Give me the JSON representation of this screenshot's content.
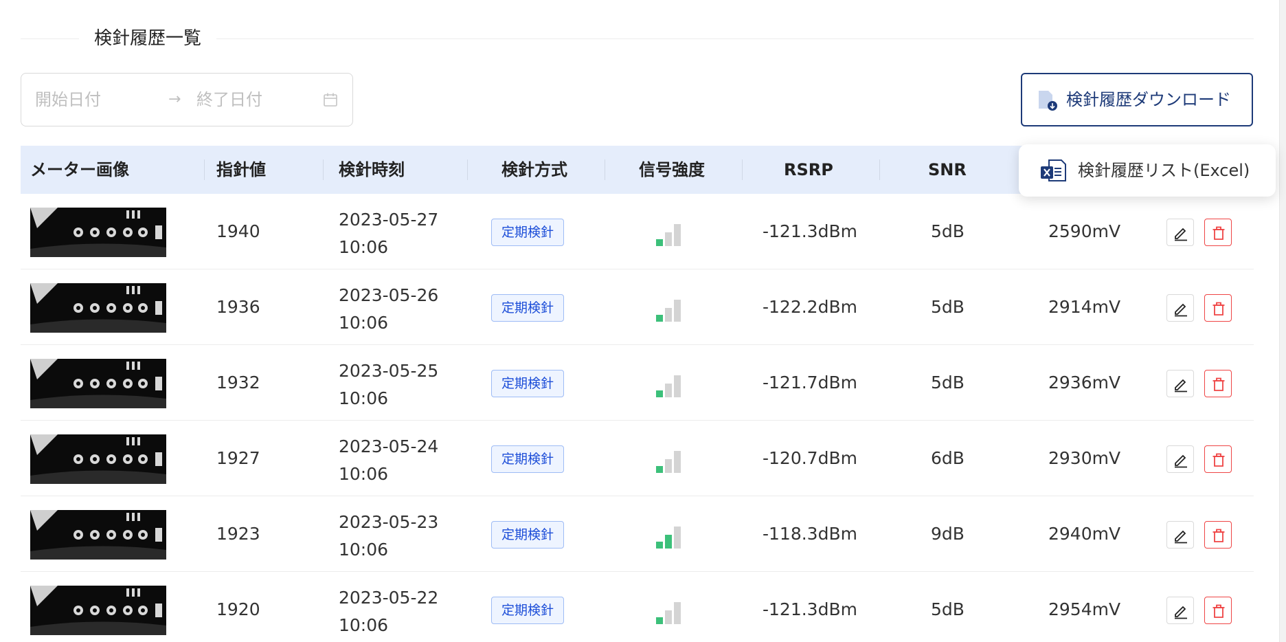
{
  "section": {
    "title": "検針履歴一覧"
  },
  "date_range": {
    "start_placeholder": "開始日付",
    "separator": "→",
    "end_placeholder": "終了日付",
    "calendar_icon": "calendar-icon"
  },
  "download": {
    "label": "検針履歴ダウンロード",
    "icon": "file-download-icon",
    "accent": "#1d3a78"
  },
  "dropdown": {
    "items": [
      {
        "label": "検針履歴リスト(Excel)",
        "icon": "excel-file-icon"
      }
    ]
  },
  "table": {
    "columns": [
      "メーター画像",
      "指針値",
      "検針時刻",
      "検針方式",
      "信号強度",
      "RSRP",
      "SNR"
    ],
    "rows": [
      {
        "value": "1940",
        "date": "2023-05-27",
        "time": "10:06",
        "method": "定期検針",
        "signal_level": 1,
        "rsrp": "-121.3dBm",
        "snr": "5dB",
        "voltage": "2590mV"
      },
      {
        "value": "1936",
        "date": "2023-05-26",
        "time": "10:06",
        "method": "定期検針",
        "signal_level": 1,
        "rsrp": "-122.2dBm",
        "snr": "5dB",
        "voltage": "2914mV"
      },
      {
        "value": "1932",
        "date": "2023-05-25",
        "time": "10:06",
        "method": "定期検針",
        "signal_level": 1,
        "rsrp": "-121.7dBm",
        "snr": "5dB",
        "voltage": "2936mV"
      },
      {
        "value": "1927",
        "date": "2023-05-24",
        "time": "10:06",
        "method": "定期検針",
        "signal_level": 1,
        "rsrp": "-120.7dBm",
        "snr": "6dB",
        "voltage": "2930mV"
      },
      {
        "value": "1923",
        "date": "2023-05-23",
        "time": "10:06",
        "method": "定期検針",
        "signal_level": 2,
        "rsrp": "-118.3dBm",
        "snr": "9dB",
        "voltage": "2940mV"
      },
      {
        "value": "1920",
        "date": "2023-05-22",
        "time": "10:06",
        "method": "定期検針",
        "signal_level": 1,
        "rsrp": "-121.3dBm",
        "snr": "5dB",
        "voltage": "2954mV"
      }
    ],
    "row_actions": {
      "edit_icon": "pencil-icon",
      "delete_icon": "trash-icon"
    }
  },
  "colors": {
    "header_bg": "#e5edfb",
    "tag_blue": "#1d4ed8",
    "signal_on": "#3cc07a",
    "signal_off": "#d4d4d4",
    "delete_red": "#ef4444"
  }
}
